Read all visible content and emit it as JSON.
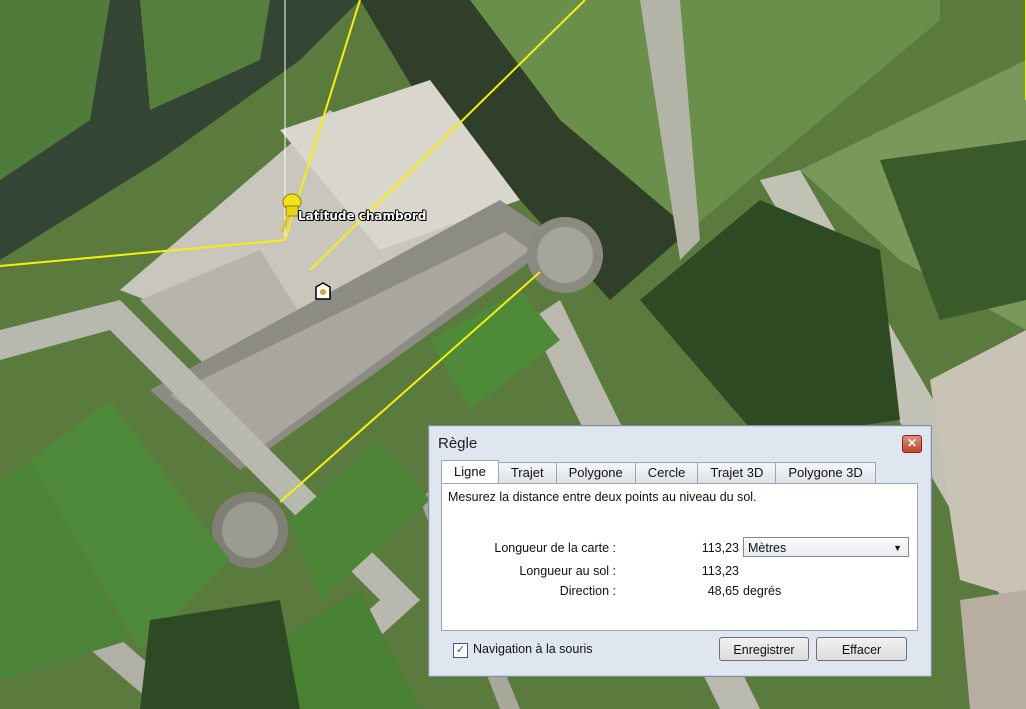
{
  "map": {
    "placemark_label": "Latitude chambord",
    "pin_color": "#f2e21a",
    "ruler_line_color": "#f5f10c"
  },
  "dialog": {
    "title": "Règle",
    "close_symbol": "✕",
    "tabs": [
      {
        "label": "Ligne",
        "active": true
      },
      {
        "label": "Trajet",
        "active": false
      },
      {
        "label": "Polygone",
        "active": false
      },
      {
        "label": "Cercle",
        "active": false
      },
      {
        "label": "Trajet 3D",
        "active": false
      },
      {
        "label": "Polygone 3D",
        "active": false
      }
    ],
    "description": "Mesurez la distance entre deux points au niveau du sol.",
    "map_length_label": "Longueur de la carte :",
    "map_length_value": "113,23",
    "unit_selected": "Mètres",
    "ground_length_label": "Longueur au sol :",
    "ground_length_value": "113,23",
    "direction_label": "Direction :",
    "direction_value": "48,65",
    "direction_unit": "degrés",
    "mouse_nav_label": "Navigation à la souris",
    "mouse_nav_checked": true,
    "save_label": "Enregistrer",
    "clear_label": "Effacer"
  },
  "icons": {
    "pin": "pushpin-icon",
    "marker": "placemark-marker-icon",
    "dropdown": "chevron-down-icon",
    "check": "checkmark-icon",
    "close": "close-icon"
  }
}
